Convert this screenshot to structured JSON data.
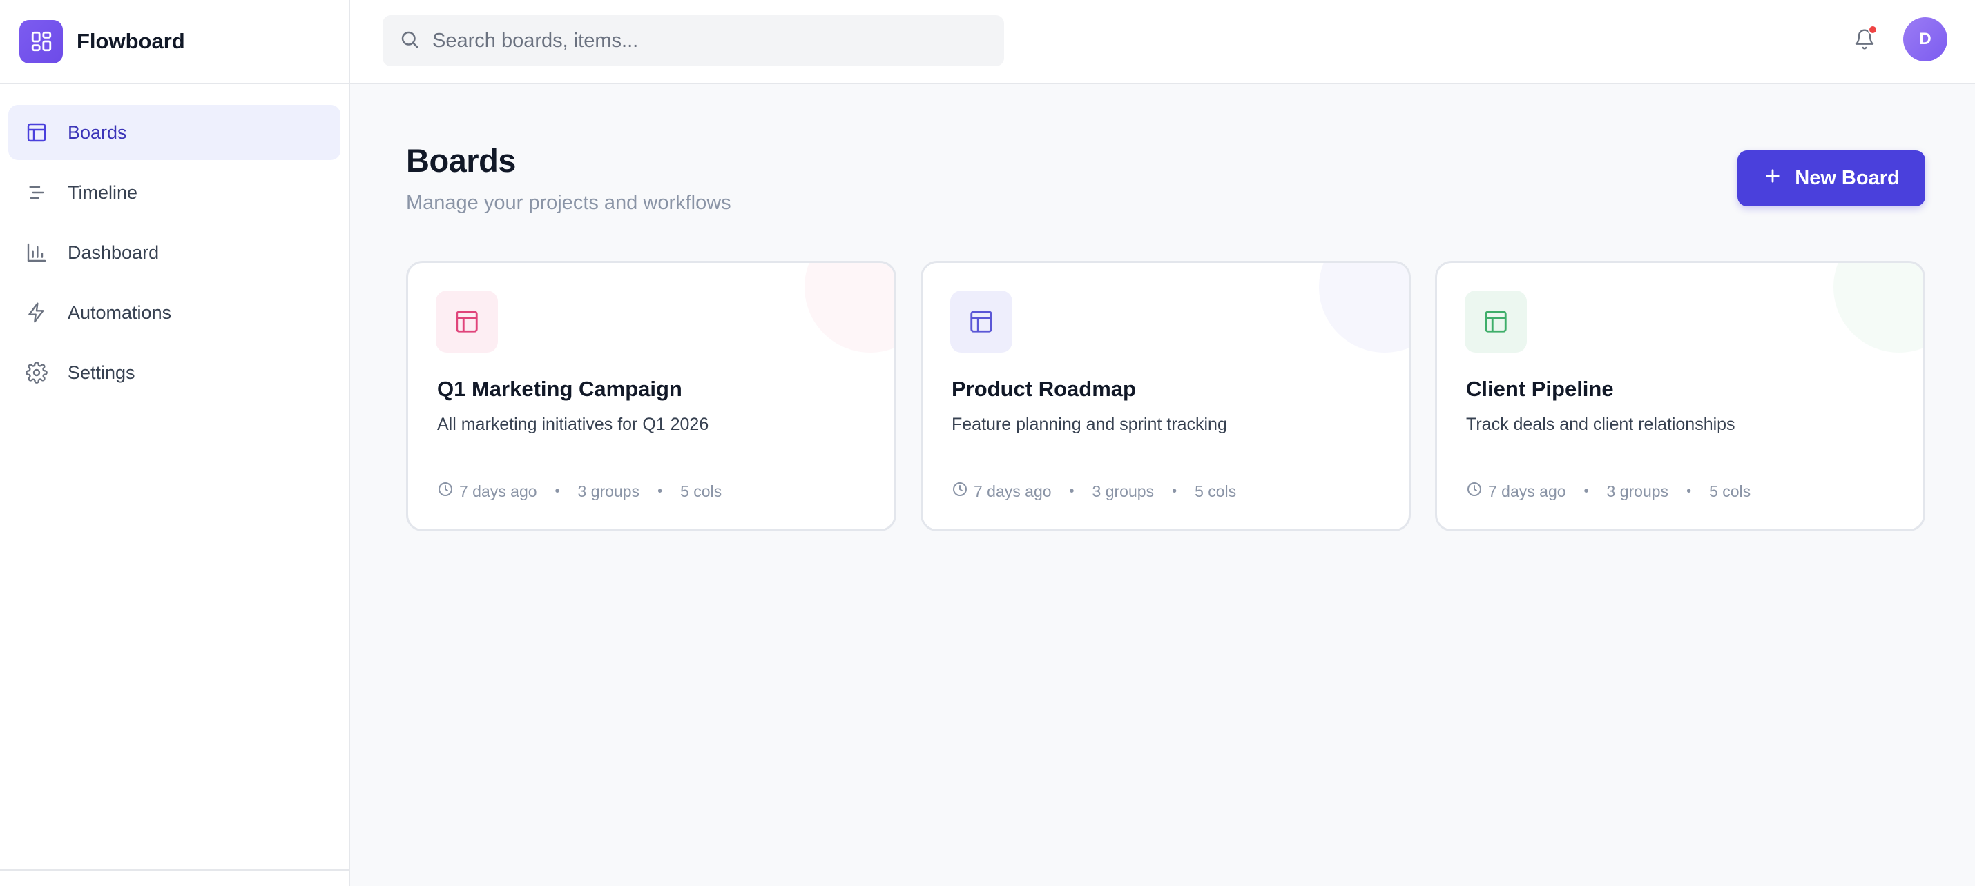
{
  "app": {
    "name": "Flowboard"
  },
  "sidebar": {
    "items": [
      {
        "label": "Boards",
        "icon": "board-icon",
        "active": true
      },
      {
        "label": "Timeline",
        "icon": "timeline-icon",
        "active": false
      },
      {
        "label": "Dashboard",
        "icon": "bar-chart-icon",
        "active": false
      },
      {
        "label": "Automations",
        "icon": "lightning-icon",
        "active": false
      },
      {
        "label": "Settings",
        "icon": "gear-icon",
        "active": false
      }
    ]
  },
  "topbar": {
    "search_placeholder": "Search boards, items...",
    "user_initial": "D"
  },
  "main": {
    "title": "Boards",
    "subtitle": "Manage your projects and workflows",
    "new_board_label": "New Board"
  },
  "boards": [
    {
      "title": "Q1 Marketing Campaign",
      "description": "All marketing initiatives for Q1 2026",
      "updated": "7 days ago",
      "groups": "3 groups",
      "cols": "5 cols",
      "accent": "#e0457b",
      "tint": "#fdeef3"
    },
    {
      "title": "Product Roadmap",
      "description": "Feature planning and sprint tracking",
      "updated": "7 days ago",
      "groups": "3 groups",
      "cols": "5 cols",
      "accent": "#5b57d6",
      "tint": "#eeeefc"
    },
    {
      "title": "Client Pipeline",
      "description": "Track deals and client relationships",
      "updated": "7 days ago",
      "groups": "3 groups",
      "cols": "5 cols",
      "accent": "#3fae6a",
      "tint": "#ecf7f0"
    }
  ],
  "colors": {
    "brand": "#6d4be8",
    "primary_button": "#4a40dc",
    "active_nav_bg": "#eef0fd",
    "notification_dot": "#ef4444"
  }
}
